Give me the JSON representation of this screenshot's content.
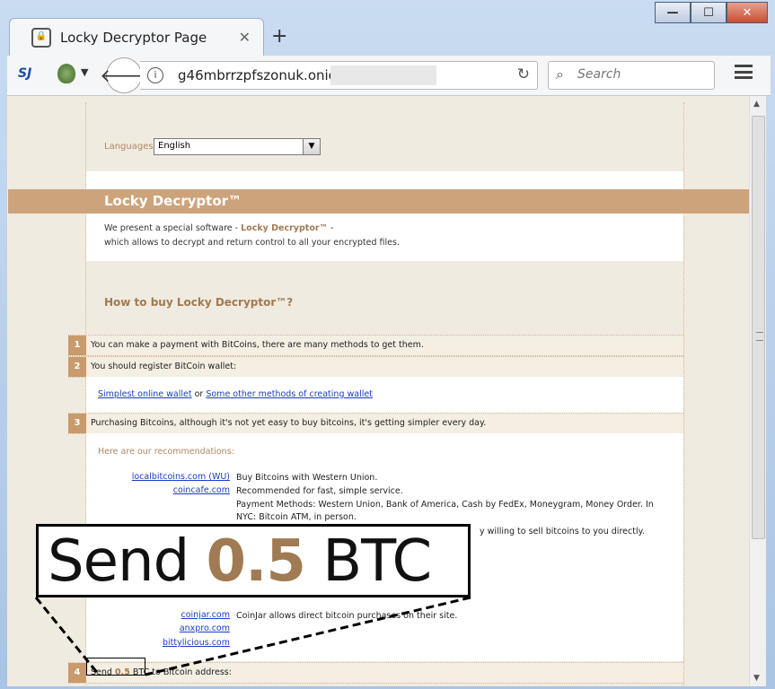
{
  "browser": {
    "tab_title": "Locky Decryptor Page",
    "url": "g46mbrrzpfszonuk.onion/",
    "search_placeholder": "Search",
    "back_icon": "arrow-left-icon",
    "reload_icon": "reload-icon",
    "menu_icon": "hamburger-menu-icon"
  },
  "page": {
    "languages_label": "Languages:",
    "language_value": "English",
    "banner_title": "Locky Decryptor™",
    "intro_line1_pre": "We present a special software - ",
    "intro_line1_product": "Locky Decryptor™",
    "intro_line1_post": " -",
    "intro_line2": "which allows to decrypt and return control to all your encrypted files.",
    "howto_title": "How to buy Locky Decryptor™?",
    "steps": [
      {
        "num": "1",
        "text": "You can make a payment with BitCoins, there are many methods to get them."
      },
      {
        "num": "2",
        "text": "You should register BitCoin wallet:"
      },
      {
        "num": "3",
        "text": "Purchasing Bitcoins, although it's not yet easy to buy bitcoins, it's getting simpler every day."
      },
      {
        "num": "4",
        "text": "Send 0.5 BTC to Bitcoin address:"
      }
    ],
    "wallet_link1": "Simplest online wallet",
    "wallet_or": " or ",
    "wallet_link2": "Some other methods of creating wallet",
    "recommendations": "Here are our recommendations:",
    "sites": [
      {
        "name": "localbitcoins.com (WU)",
        "desc": "Buy Bitcoins with Western Union."
      },
      {
        "name": "coincafe.com",
        "desc": "Recommended for fast, simple service."
      },
      {
        "name": "",
        "desc": "Payment Methods: Western Union, Bank of America, Cash by FedEx, Moneygram, Money Order. In NYC: Bitcoin ATM, in person."
      },
      {
        "name": "",
        "desc": "y willing to sell bitcoins to you directly."
      },
      {
        "name": "coinjar.com",
        "desc": "CoinJar allows direct bitcoin purchases on their site."
      },
      {
        "name": "anxpro.com",
        "desc": ""
      },
      {
        "name": "bittylicious.com",
        "desc": ""
      }
    ]
  },
  "callout": {
    "send": "Send",
    "amount": "0.5",
    "currency": "BTC"
  },
  "colors": {
    "accent": "#cda37c",
    "accent_text": "#a07a52",
    "link": "#1a3cc8"
  }
}
